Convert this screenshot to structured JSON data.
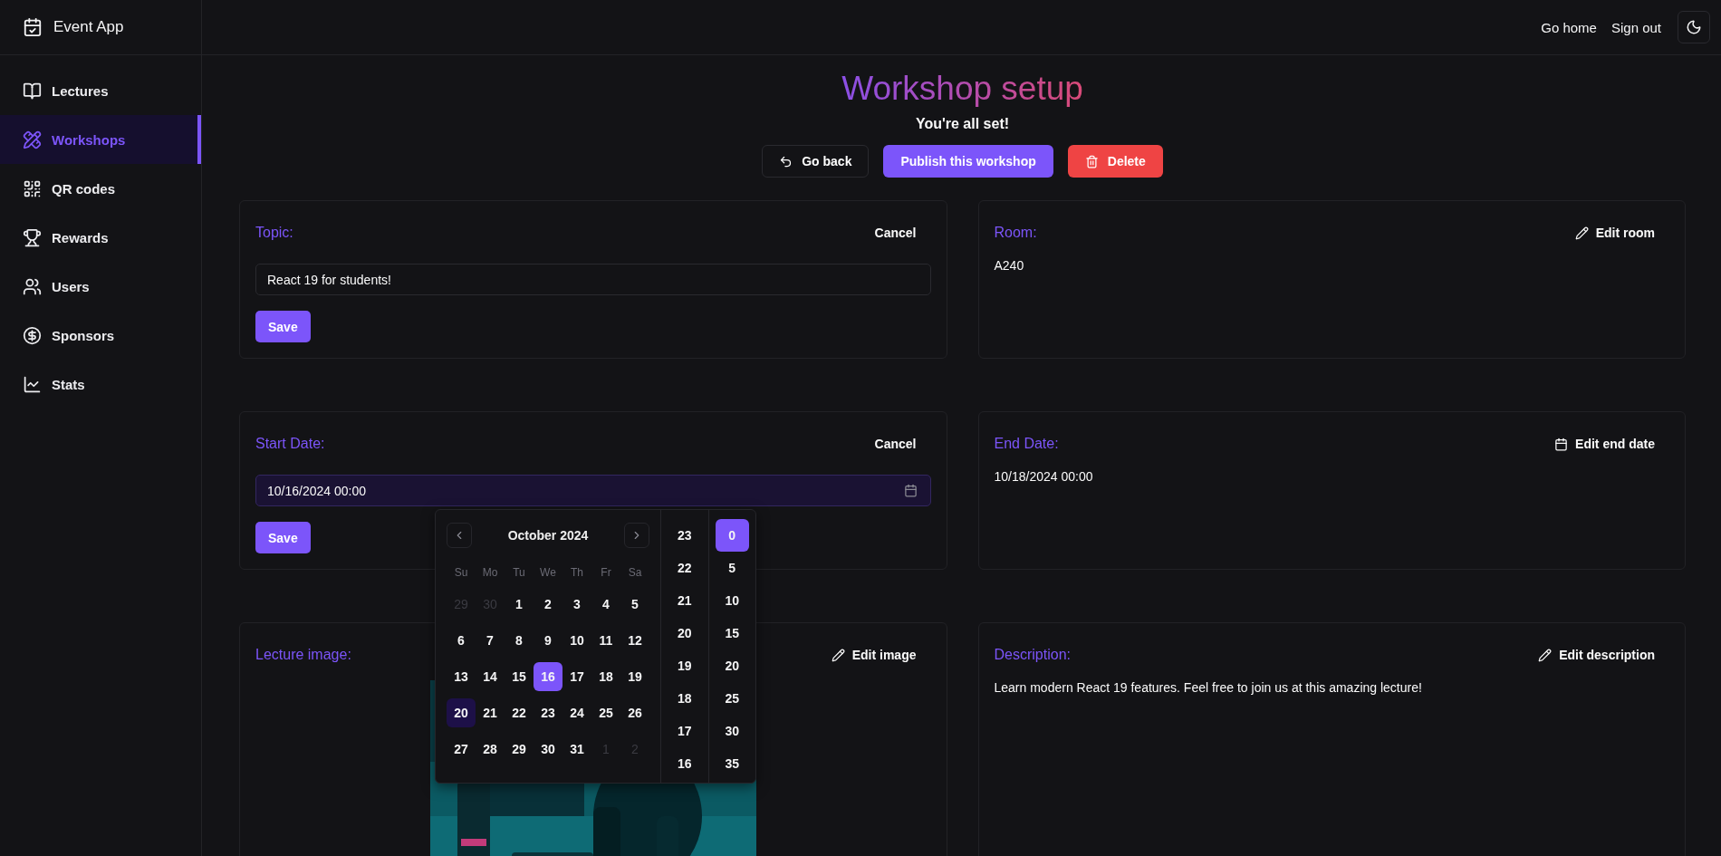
{
  "app": {
    "name": "Event App"
  },
  "header": {
    "links": [
      "Go home",
      "Sign out"
    ]
  },
  "sidebar": {
    "items": [
      {
        "label": "Lectures",
        "kind": "book",
        "selected": false
      },
      {
        "label": "Workshops",
        "kind": "tools",
        "selected": true
      },
      {
        "label": "QR codes",
        "kind": "qr",
        "selected": false
      },
      {
        "label": "Rewards",
        "kind": "trophy",
        "selected": false
      },
      {
        "label": "Users",
        "kind": "users",
        "selected": false
      },
      {
        "label": "Sponsors",
        "kind": "money",
        "selected": false
      },
      {
        "label": "Stats",
        "kind": "chart",
        "selected": false
      }
    ]
  },
  "page": {
    "title": "Workshop setup",
    "subtitle": "You're all set!",
    "actions": [
      {
        "label": "Go back",
        "kind": "back"
      },
      {
        "label": "Publish this workshop",
        "kind": "primary"
      },
      {
        "label": "Delete",
        "kind": "danger"
      }
    ]
  },
  "fields": [
    {
      "kind": "text_input",
      "label": "Topic:",
      "action": "Cancel",
      "value": "React 19 for students!",
      "save": "Save"
    },
    {
      "kind": "text",
      "label": "Room:",
      "action": "Edit room",
      "value": "A240"
    },
    {
      "kind": "date_input",
      "label": "Start Date:",
      "action": "Cancel",
      "value": "10/16/2024 00:00",
      "save": "Save"
    },
    {
      "kind": "date_text",
      "label": "End Date:",
      "action": "Edit end date",
      "value": "10/18/2024 00:00"
    },
    {
      "label": "Lecture image:",
      "action": "Edit image"
    },
    {
      "kind": "text",
      "label": "Description:",
      "action": "Edit description",
      "value": "Learn modern React 19 features. Feel free to join us at this amazing lecture!"
    }
  ],
  "date_picker": {
    "month": "October 2024",
    "weekdays": [
      "Su",
      "Mo",
      "Tu",
      "We",
      "Th",
      "Fr",
      "Sa"
    ],
    "weeks": [
      [
        {
          "day": "29",
          "outside": true,
          "selected": false,
          "today": false
        },
        {
          "day": "30",
          "outside": true,
          "selected": false,
          "today": false
        },
        {
          "day": "1",
          "outside": false,
          "selected": false,
          "today": false
        },
        {
          "day": "2",
          "outside": false,
          "selected": false,
          "today": false
        },
        {
          "day": "3",
          "outside": false,
          "selected": false,
          "today": false
        },
        {
          "day": "4",
          "outside": false,
          "selected": false,
          "today": false
        },
        {
          "day": "5",
          "outside": false,
          "selected": false,
          "today": false
        }
      ],
      [
        {
          "day": "6",
          "outside": false,
          "selected": false,
          "today": false
        },
        {
          "day": "7",
          "outside": false,
          "selected": false,
          "today": false
        },
        {
          "day": "8",
          "outside": false,
          "selected": false,
          "today": false
        },
        {
          "day": "9",
          "outside": false,
          "selected": false,
          "today": false
        },
        {
          "day": "10",
          "outside": false,
          "selected": false,
          "today": false
        },
        {
          "day": "11",
          "outside": false,
          "selected": false,
          "today": false
        },
        {
          "day": "12",
          "outside": false,
          "selected": false,
          "today": false
        }
      ],
      [
        {
          "day": "13",
          "outside": false,
          "selected": false,
          "today": false
        },
        {
          "day": "14",
          "outside": false,
          "selected": false,
          "today": false
        },
        {
          "day": "15",
          "outside": false,
          "selected": false,
          "today": false
        },
        {
          "day": "16",
          "outside": false,
          "selected": true,
          "today": false
        },
        {
          "day": "17",
          "outside": false,
          "selected": false,
          "today": false
        },
        {
          "day": "18",
          "outside": false,
          "selected": false,
          "today": false
        },
        {
          "day": "19",
          "outside": false,
          "selected": false,
          "today": false
        }
      ],
      [
        {
          "day": "20",
          "outside": false,
          "selected": false,
          "today": true
        },
        {
          "day": "21",
          "outside": false,
          "selected": false,
          "today": false
        },
        {
          "day": "22",
          "outside": false,
          "selected": false,
          "today": false
        },
        {
          "day": "23",
          "outside": false,
          "selected": false,
          "today": false
        },
        {
          "day": "24",
          "outside": false,
          "selected": false,
          "today": false
        },
        {
          "day": "25",
          "outside": false,
          "selected": false,
          "today": false
        },
        {
          "day": "26",
          "outside": false,
          "selected": false,
          "today": false
        }
      ],
      [
        {
          "day": "27",
          "outside": false,
          "selected": false,
          "today": false
        },
        {
          "day": "28",
          "outside": false,
          "selected": false,
          "today": false
        },
        {
          "day": "29",
          "outside": false,
          "selected": false,
          "today": false
        },
        {
          "day": "30",
          "outside": false,
          "selected": false,
          "today": false
        },
        {
          "day": "31",
          "outside": false,
          "selected": false,
          "today": false
        },
        {
          "day": "1",
          "outside": true,
          "selected": false,
          "today": false
        },
        {
          "day": "2",
          "outside": true,
          "selected": false,
          "today": false
        }
      ]
    ],
    "hours": [
      {
        "label": "23",
        "selected": false
      },
      {
        "label": "22",
        "selected": false
      },
      {
        "label": "21",
        "selected": false
      },
      {
        "label": "20",
        "selected": false
      },
      {
        "label": "19",
        "selected": false
      },
      {
        "label": "18",
        "selected": false
      },
      {
        "label": "17",
        "selected": false
      },
      {
        "label": "16",
        "selected": false
      }
    ],
    "minutes": [
      {
        "label": "0",
        "selected": true
      },
      {
        "label": "5",
        "selected": false
      },
      {
        "label": "10",
        "selected": false
      },
      {
        "label": "15",
        "selected": false
      },
      {
        "label": "20",
        "selected": false
      },
      {
        "label": "25",
        "selected": false
      },
      {
        "label": "30",
        "selected": false
      },
      {
        "label": "35",
        "selected": false
      }
    ]
  }
}
